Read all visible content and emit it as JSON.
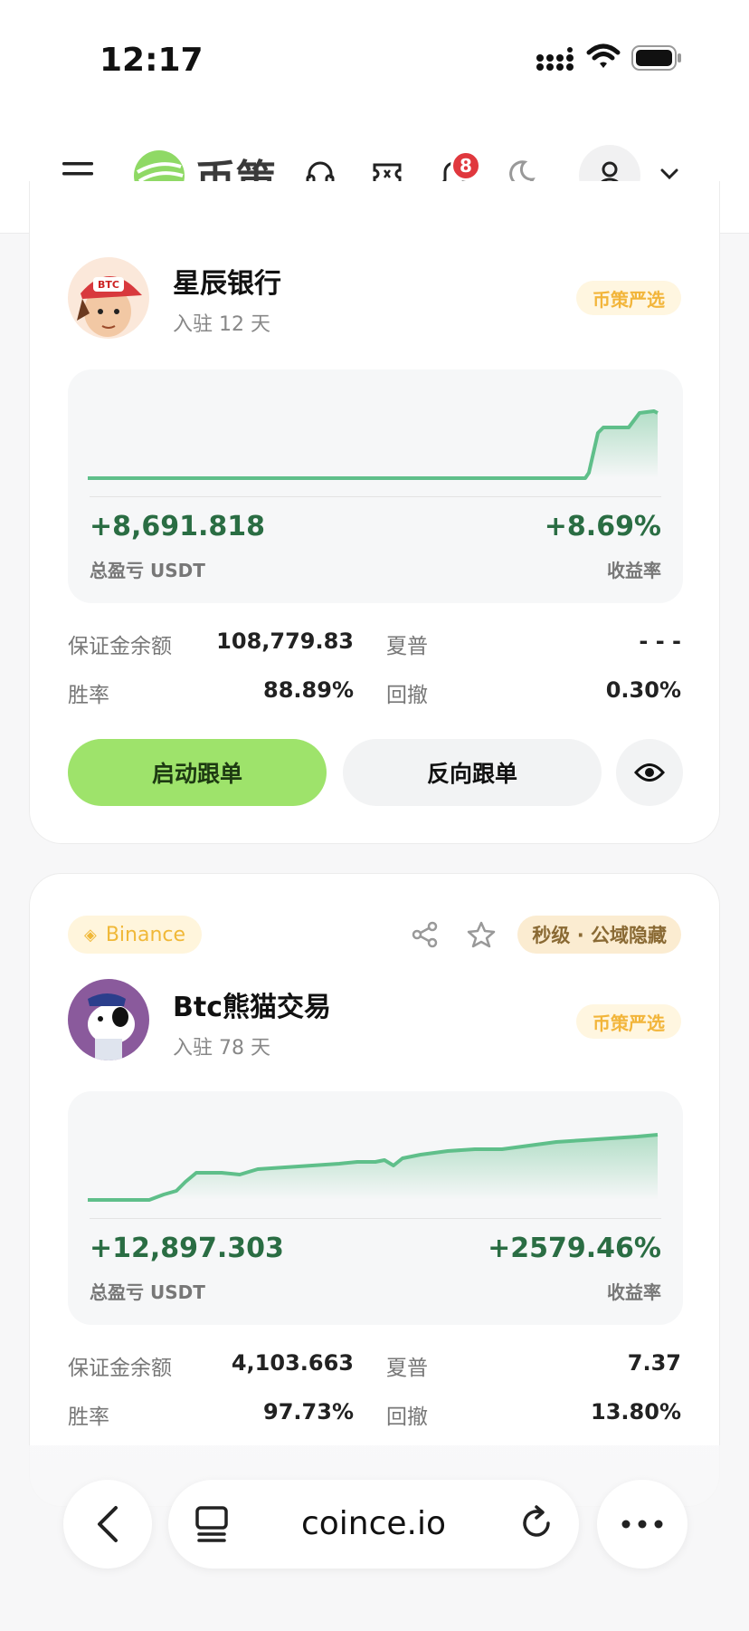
{
  "status_bar": {
    "time": "12:17"
  },
  "header": {
    "logo_text": "币策",
    "notification_count": "8"
  },
  "traders": [
    {
      "name": "星辰银行",
      "joined": "入驻 12 天",
      "tag": "币策严选",
      "pnl": "+8,691.818",
      "pnl_label": "总盈亏 USDT",
      "roi": "+8.69%",
      "roi_label": "收益率",
      "stats": {
        "margin_label": "保证金余额",
        "margin_value": "108,779.83",
        "sharpe_label": "夏普",
        "sharpe_value": "- - -",
        "winrate_label": "胜率",
        "winrate_value": "88.89%",
        "drawdown_label": "回撤",
        "drawdown_value": "0.30%"
      },
      "actions": {
        "start_label": "启动跟单",
        "reverse_label": "反向跟单"
      }
    },
    {
      "exchange": "Binance",
      "visibility_tag": "秒级 · 公域隐藏",
      "name": "Btc熊猫交易",
      "joined": "入驻 78 天",
      "tag": "币策严选",
      "pnl": "+12,897.303",
      "pnl_label": "总盈亏 USDT",
      "roi": "+2579.46%",
      "roi_label": "收益率",
      "stats": {
        "margin_label": "保证金余额",
        "margin_value": "4,103.663",
        "sharpe_label": "夏普",
        "sharpe_value": "7.37",
        "winrate_label": "胜率",
        "winrate_value": "97.73%",
        "drawdown_label": "回撤",
        "drawdown_value": "13.80%"
      }
    }
  ],
  "browser": {
    "url": "coince.io"
  },
  "colors": {
    "accent": "#9ee36b",
    "profit": "#2a6d43",
    "tag": "#f2b53a",
    "badge": "#e0383e"
  }
}
